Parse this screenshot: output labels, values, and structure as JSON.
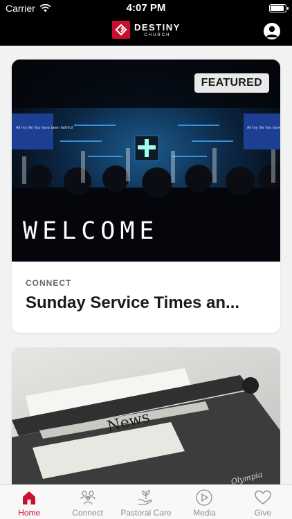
{
  "status_bar": {
    "carrier": "Carrier",
    "time": "4:07 PM"
  },
  "header": {
    "brand_name": "DESTINY",
    "brand_sub": "CHURCH"
  },
  "cards": [
    {
      "badge": "FEATURED",
      "image_text": "WELCOME",
      "image_screen_text": "All my life You have been faithful",
      "category": "CONNECT",
      "title": "Sunday Service Times an..."
    },
    {
      "image_text": "News",
      "image_brand": "Olympia"
    }
  ],
  "tabs": [
    {
      "label": "Home",
      "icon": "home-icon",
      "active": true
    },
    {
      "label": "Connect",
      "icon": "people-icon",
      "active": false
    },
    {
      "label": "Pastoral Care",
      "icon": "hands-plant-icon",
      "active": false
    },
    {
      "label": "Media",
      "icon": "play-icon",
      "active": false
    },
    {
      "label": "Give",
      "icon": "heart-icon",
      "active": false
    }
  ],
  "colors": {
    "accent": "#c8102e",
    "header_bg": "#000000",
    "inactive": "#8e8e93"
  }
}
